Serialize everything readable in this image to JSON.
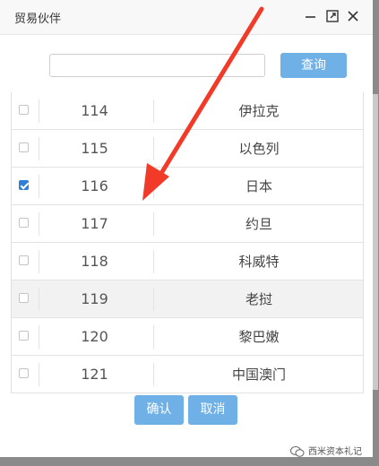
{
  "dialog": {
    "title": "贸易伙伴",
    "controls": [
      "minimize-icon",
      "maximize-icon",
      "close-icon"
    ]
  },
  "search": {
    "value": "",
    "placeholder": "",
    "button_label": "查询"
  },
  "table": {
    "rows": [
      {
        "checked": false,
        "code": "114",
        "name": "伊拉克"
      },
      {
        "checked": false,
        "code": "115",
        "name": "以色列"
      },
      {
        "checked": true,
        "code": "116",
        "name": "日本"
      },
      {
        "checked": false,
        "code": "117",
        "name": "约旦"
      },
      {
        "checked": false,
        "code": "118",
        "name": "科威特"
      },
      {
        "checked": false,
        "code": "119",
        "name": "老挝"
      },
      {
        "checked": false,
        "code": "120",
        "name": "黎巴嫩"
      },
      {
        "checked": false,
        "code": "121",
        "name": "中国澳门"
      }
    ]
  },
  "footer": {
    "confirm_label": "确认",
    "cancel_label": "取消"
  },
  "watermark": {
    "text": "西米资本礼记",
    "icon": "wechat-icon"
  },
  "colors": {
    "accent": "#6fb0e6",
    "checkbox_checked": "#2f7fd8",
    "arrow": "#f23a28",
    "highlight_row": "#f2f2f2"
  }
}
